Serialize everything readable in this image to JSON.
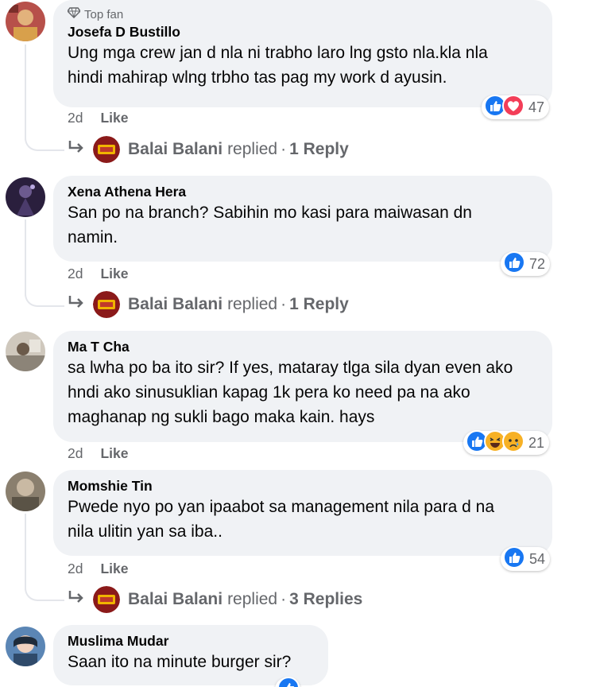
{
  "comments": [
    {
      "badge": "Top fan",
      "author": "Josefa D Bustillo",
      "text": "Ung mga crew jan d nla ni trabho laro lng gsto nla.kla nla hindi mahirap wlng trbho tas pag my work d ayusin.",
      "time": "2d",
      "like": "Like",
      "reaction_count": "47",
      "reactions": [
        "like-icon",
        "love-icon"
      ],
      "reply": {
        "page": "Balai Balani",
        "replied": "replied",
        "sep": "·",
        "count": "1 Reply"
      }
    },
    {
      "author": "Xena Athena Hera",
      "text": "San po na branch? Sabihin mo kasi para maiwasan dn namin.",
      "time": "2d",
      "like": "Like",
      "reaction_count": "72",
      "reactions": [
        "like-icon"
      ],
      "reply": {
        "page": "Balai Balani",
        "replied": "replied",
        "sep": "·",
        "count": "1 Reply"
      }
    },
    {
      "author": "Ma T Cha",
      "text": "sa lwha po ba ito sir? If yes, mataray tlga sila dyan even ako hndi ako sinusuklian kapag 1k pera ko need pa na ako maghanap ng sukli bago maka kain. hays",
      "time": "2d",
      "like": "Like",
      "reaction_count": "21",
      "reactions": [
        "like-icon",
        "haha-icon",
        "sad-icon"
      ]
    },
    {
      "author": "Momshie Tin",
      "text": "Pwede nyo po yan ipaabot sa management nila para d na nila ulitin yan sa iba..",
      "time": "2d",
      "like": "Like",
      "reaction_count": "54",
      "reactions": [
        "like-icon"
      ],
      "reply": {
        "page": "Balai Balani",
        "replied": "replied",
        "sep": "·",
        "count": "3 Replies"
      }
    },
    {
      "author": "Muslima Mudar",
      "text": "Saan ito na minute burger sir?",
      "reactions": [
        "like-icon"
      ]
    }
  ],
  "colors": {
    "bubble": "#f0f2f5",
    "like_blue": "#1877f2",
    "love_red": "#f33e58",
    "muted": "#65676b"
  }
}
